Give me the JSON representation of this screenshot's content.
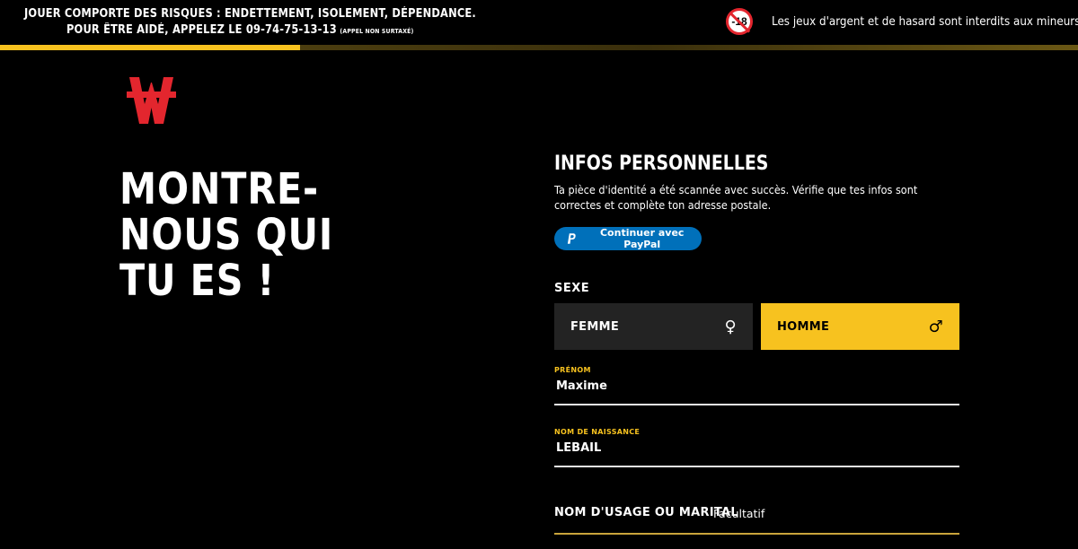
{
  "banner": {
    "warning_line1": "JOUER COMPORTE DES RISQUES : ENDETTEMENT, ISOLEMENT, DÉPENDANCE.",
    "warning_line2": "POUR ÊTRE AIDÉ, APPELEZ LE 09-74-75-13-13",
    "warning_small": "(APPEL NON SURTAXÉ)",
    "age_badge": "-18",
    "minors_text": "Les jeux d'argent et de hasard sont interdits aux mineurs"
  },
  "progress": {
    "fraction": 0.278
  },
  "logo": {
    "icon": "winamax-w-logo",
    "color": "#e3262e"
  },
  "headline": {
    "line1": "MONTRE-",
    "line2": "NOUS QUI",
    "line3": "TU ES !"
  },
  "form": {
    "title": "INFOS PERSONNELLES",
    "description": "Ta pièce d'identité a été scannée avec succès. Vérifie que tes infos sont correctes et complète ton adresse postale.",
    "paypal_button": "Continuer avec PayPal",
    "sexe_label": "SEXE",
    "sexe_options": [
      {
        "label": "FEMME",
        "symbol": "♀",
        "selected": false
      },
      {
        "label": "HOMME",
        "symbol": "♂",
        "selected": true
      }
    ],
    "prenom": {
      "label": "PRÉNOM",
      "value": "Maxime"
    },
    "nom_naissance": {
      "label": "NOM DE NAISSANCE",
      "value": "LEBAIL"
    },
    "nom_usage": {
      "label": "NOM D'USAGE OU MARITAL",
      "optional": "Facultatif"
    }
  },
  "colors": {
    "accent": "#f7c21f",
    "brand_red": "#e3262e",
    "paypal_blue": "#0070ba",
    "background": "#000000"
  }
}
